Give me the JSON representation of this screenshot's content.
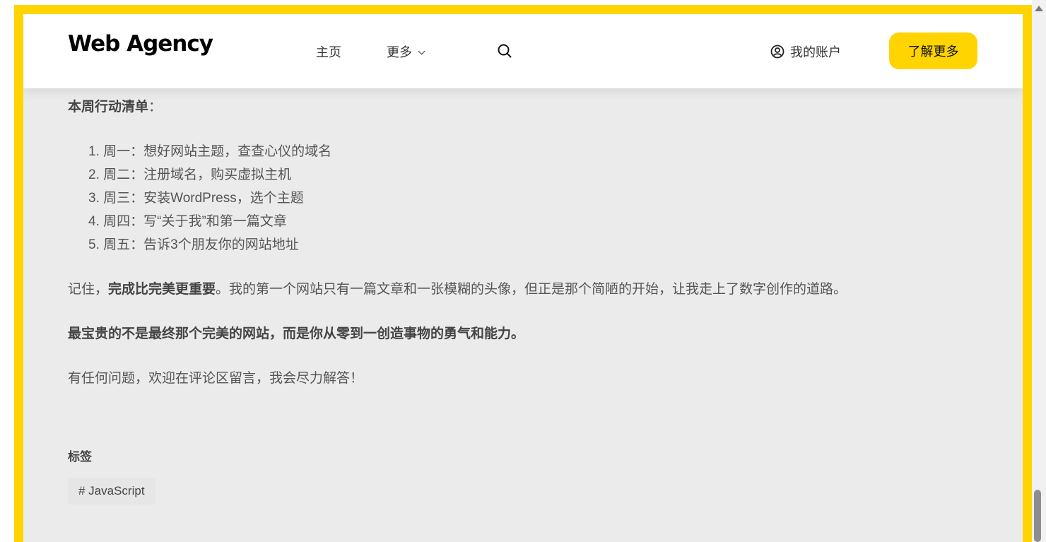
{
  "header": {
    "logo": "Web Agency",
    "nav": {
      "home": "主页",
      "more": "更多"
    },
    "account": "我的账户",
    "cta": "了解更多"
  },
  "article": {
    "action_title": "本周行动清单",
    "action_colon": "：",
    "steps": [
      "1. 周一：想好网站主题，查查心仪的域名",
      "2. 周二：注册域名，购买虚拟主机",
      "3. 周三：安装WordPress，选个主题",
      "4. 周四：写“关于我”和第一篇文章",
      "5. 周五：告诉3个朋友你的网站地址"
    ],
    "remember_prefix": "记住，",
    "remember_bold": "完成比完美更重要",
    "remember_suffix": "。我的第一个网站只有一篇文章和一张模糊的头像，但正是那个简陋的开始，让我走上了数字创作的道路。",
    "precious": "最宝贵的不是最终那个完美的网站，而是你从零到一创造事物的勇气和能力。",
    "questions": "有任何问题，欢迎在评论区留言，我会尽力解答！"
  },
  "tags": {
    "title": "标签",
    "items": [
      "# JavaScript"
    ]
  },
  "colors": {
    "accent": "#FFD400",
    "content_bg": "#ebebeb",
    "text": "#555555"
  }
}
